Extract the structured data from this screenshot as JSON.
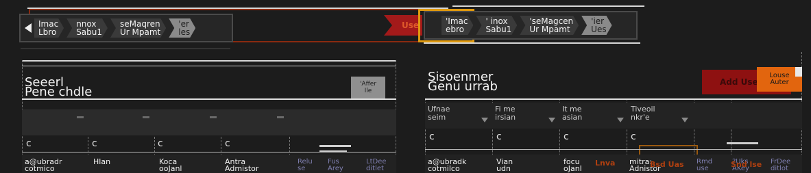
{
  "colors": {
    "background": "#1c1c1c",
    "accent_red": "#a31a1a",
    "accent_orange": "#e2650e",
    "highlight": "#e09a10"
  },
  "left_strip": {
    "back_icon": "chevron-left-icon",
    "tabs": [
      {
        "line1": "Imac",
        "line2": "Lbro"
      },
      {
        "line1": "nnox",
        "line2": "Sabu1"
      },
      {
        "line1": "seMaqren",
        "line2": "Ur Mpamt"
      },
      {
        "line1": "'er",
        "line2": "les"
      }
    ]
  },
  "users_link": {
    "label": "Use"
  },
  "right_strip": {
    "tabs": [
      {
        "line1": "'Imac",
        "line2": "ebro"
      },
      {
        "line1": "' inox",
        "line2": "Sabu1"
      },
      {
        "line1": "'seMagcen",
        "line2": "Ur Mpamt"
      },
      {
        "line1": "'ier",
        "line2": "Ues"
      }
    ]
  },
  "left_panel": {
    "title_line1": "Seeerl",
    "title_line2": "Pene chdle",
    "button_line1": "'Affer",
    "button_line2": "Ile",
    "filter_values": [
      "c",
      "c",
      "c",
      "c"
    ],
    "row": {
      "email_line1": "a@ubradr",
      "email_line2": "cotmico",
      "first": "Hlan",
      "last_line1": "Koca",
      "last_line2": "ooJanl",
      "role_line1": "Antra",
      "role_line2": "Admistor",
      "act1_line1": "Relu",
      "act1_line2": "se",
      "act2_line1": "Fus",
      "act2_line2": "Arey",
      "act3_line1": "LtDee",
      "act3_line2": "ditlet"
    }
  },
  "right_panel": {
    "title_line1": "Sisoenmer",
    "title_line2": "Genu urrab",
    "add_button": "Add Use",
    "add_chip_line1": "Louse",
    "add_chip_line2": "Auter",
    "headers": [
      {
        "h1": "Ufnae",
        "h2": "seim"
      },
      {
        "h1": "Fi me",
        "h2": "irsian"
      },
      {
        "h1": "It me",
        "h2": "asian"
      },
      {
        "h1": "Tiveoil",
        "h2": "nkr'e"
      }
    ],
    "filter_values": [
      "c",
      "c",
      "c",
      "c"
    ],
    "row": {
      "email_line1": "a@ubradk",
      "email_line2": "cotmilco",
      "first_line1": "Vian",
      "first_line2": "udn",
      "last_line1": "focu",
      "last_line2": "oJanl",
      "role_line1": "mitra:",
      "role_line2": "Adnistor",
      "act1_line1": "Rmd",
      "act1_line2": "use",
      "act2_line1": "?Uks",
      "act2_line2": "AKey",
      "act3_line1": "FrDee",
      "act3_line2": "ditlot",
      "red_action1": "Lnva",
      "red_action2": "Bsd Uas",
      "red_action3": "Snd lse"
    }
  }
}
